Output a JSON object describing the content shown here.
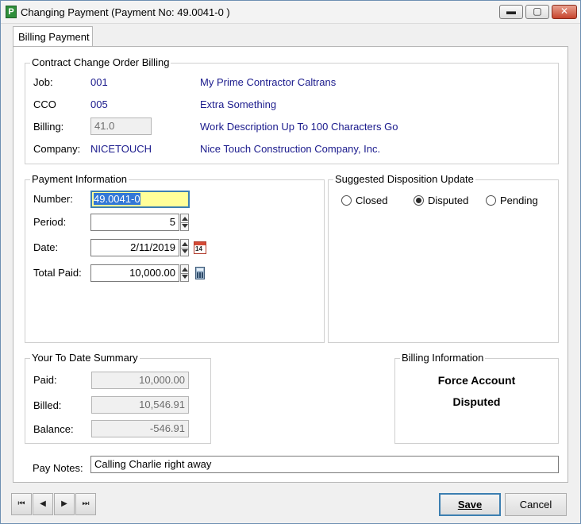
{
  "window": {
    "title": "Changing Payment  (Payment No: 49.0041-0 )",
    "app_icon": "P",
    "minimize": "▬",
    "maximize": "▢",
    "close": "✕"
  },
  "tab": {
    "label": "Billing Payment"
  },
  "cco_billing": {
    "title": "Contract Change Order Billing",
    "job_label": "Job:",
    "job_value": "001",
    "job_desc": "My Prime Contractor Caltrans",
    "cco_label": "CCO",
    "cco_value": "005",
    "cco_desc": "Extra Something",
    "billing_label": "Billing:",
    "billing_value": "41.0",
    "billing_desc": "Work Description Up To 100 Characters Go",
    "company_label": "Company:",
    "company_value": "NICETOUCH",
    "company_desc": "Nice Touch Construction Company, Inc."
  },
  "payment_info": {
    "title": "Payment Information",
    "number_label": "Number:",
    "number_value": "49.0041-0",
    "period_label": "Period:",
    "period_value": "5",
    "date_label": "Date:",
    "date_value": "2/11/2019",
    "total_label": "Total Paid:",
    "total_value": "10,000.00",
    "calendar_day": "14"
  },
  "disposition": {
    "title": "Suggested Disposition Update",
    "options": [
      "Closed",
      "Disputed",
      "Pending"
    ],
    "selected": "Disputed"
  },
  "summary": {
    "title": "Your To Date Summary",
    "paid_label": "Paid:",
    "paid_value": "10,000.00",
    "billed_label": "Billed:",
    "billed_value": "10,546.91",
    "balance_label": "Balance:",
    "balance_value": "-546.91"
  },
  "billing_info": {
    "title": "Billing Information",
    "line1": "Force Account",
    "line2": "Disputed"
  },
  "pay_notes": {
    "label": "Pay Notes:",
    "value": "Calling Charlie right away"
  },
  "nav": {
    "first": "⏮",
    "prev": "◀",
    "next": "▶",
    "last": "⏭"
  },
  "buttons": {
    "save": "Save",
    "cancel": "Cancel"
  }
}
